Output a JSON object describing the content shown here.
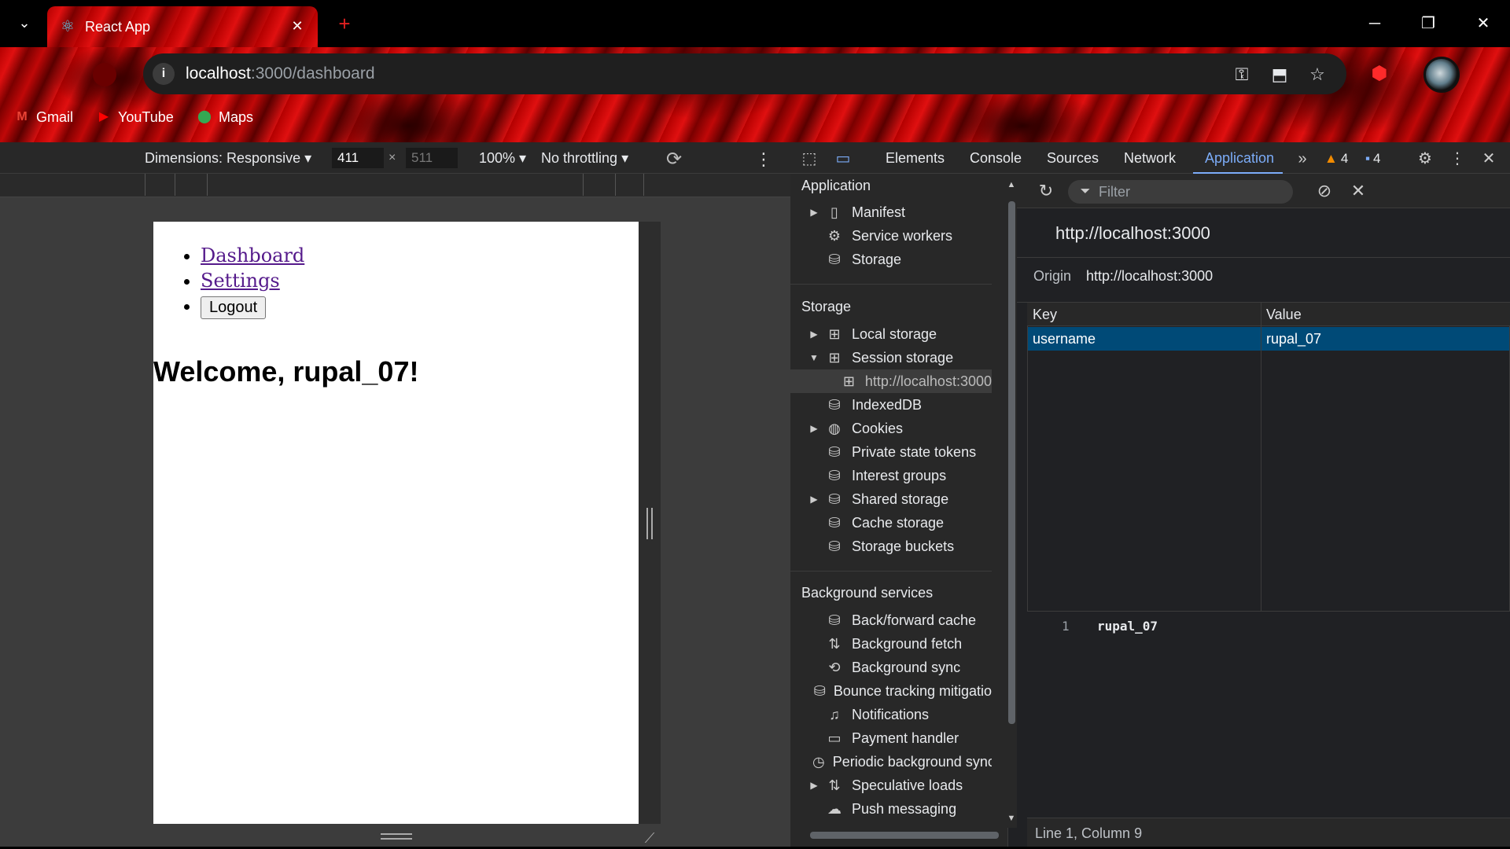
{
  "browser": {
    "tab": {
      "title": "React App"
    },
    "address": {
      "host": "localhost",
      "path": ":3000/dashboard"
    },
    "bookmarks": [
      {
        "label": "Gmail",
        "icon": "gmail-icon"
      },
      {
        "label": "YouTube",
        "icon": "youtube-icon"
      },
      {
        "label": "Maps",
        "icon": "maps-icon"
      }
    ]
  },
  "device_toolbar": {
    "dimensions": "Dimensions: Responsive",
    "width": "411",
    "height": "511",
    "x": "×",
    "zoom": "100%",
    "throttling": "No throttling"
  },
  "page": {
    "nav": [
      "Dashboard",
      "Settings"
    ],
    "logout": "Logout",
    "heading": "Welcome, rupal_07!"
  },
  "devtools": {
    "tabs": [
      "Elements",
      "Console",
      "Sources",
      "Network",
      "Application"
    ],
    "active_tab": "Application",
    "warnings": "4",
    "messages": "4",
    "sidebar": {
      "application_title": "Application",
      "application_items": [
        "Manifest",
        "Service workers",
        "Storage"
      ],
      "storage_title": "Storage",
      "storage_items": [
        "Local storage",
        "Session storage",
        "http://localhost:3000",
        "IndexedDB",
        "Cookies",
        "Private state tokens",
        "Interest groups",
        "Shared storage",
        "Cache storage",
        "Storage buckets"
      ],
      "background_title": "Background services",
      "background_items": [
        "Back/forward cache",
        "Background fetch",
        "Background sync",
        "Bounce tracking mitigatio",
        "Notifications",
        "Payment handler",
        "Periodic background sync",
        "Speculative loads",
        "Push messaging"
      ]
    },
    "main": {
      "filter_placeholder": "Filter",
      "origin_title": "http://localhost:3000",
      "origin_label": "Origin",
      "origin_value": "http://localhost:3000",
      "columns": [
        "Key",
        "Value"
      ],
      "rows": [
        {
          "key": "username",
          "value": "rupal_07"
        }
      ],
      "preview_line_no": "1",
      "preview_value": "rupal_07",
      "status": "Line 1, Column 9"
    }
  },
  "colors": {
    "accent": "#7cacf8",
    "selected_row": "#004a77",
    "link": "#551a8b"
  }
}
